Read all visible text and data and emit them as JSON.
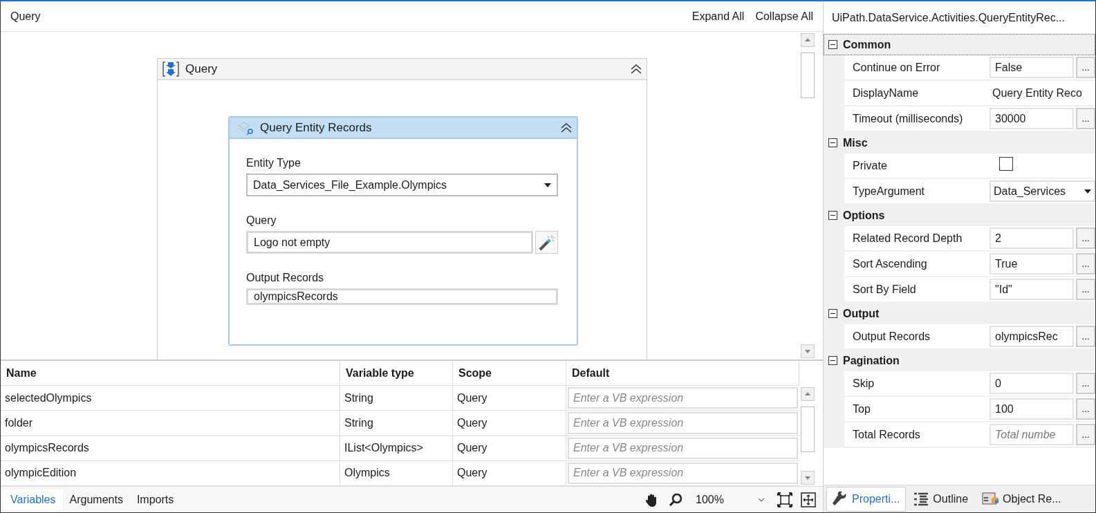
{
  "designer": {
    "breadcrumb": "Query",
    "actions": [
      "Expand All",
      "Collapse All"
    ],
    "sequence": {
      "title": "Query"
    },
    "activity": {
      "title": "Query Entity Records",
      "fields": [
        {
          "label": "Entity Type",
          "kind": "dropdown",
          "value": "Data_Services_File_Example.Olympics"
        },
        {
          "label": "Query",
          "kind": "builder",
          "value": "Logo not empty"
        },
        {
          "label": "Output Records",
          "kind": "text",
          "value": "olympicsRecords"
        }
      ]
    }
  },
  "variables": {
    "columns": [
      "Name",
      "Variable type",
      "Scope",
      "Default"
    ],
    "rows": [
      {
        "name": "selectedOlympics",
        "type": "String",
        "scope": "Query",
        "default_placeholder": "Enter a VB expression"
      },
      {
        "name": "folder",
        "type": "String",
        "scope": "Query",
        "default_placeholder": "Enter a VB expression"
      },
      {
        "name": "olympicsRecords",
        "type": "IList<Olympics>",
        "scope": "Query",
        "default_placeholder": "Enter a VB expression"
      },
      {
        "name": "olympicEdition",
        "type": "Olympics",
        "scope": "Query",
        "default_placeholder": "Enter a VB expression"
      }
    ]
  },
  "bottom_bar": {
    "tabs": [
      {
        "label": "Variables",
        "selected": true
      },
      {
        "label": "Arguments",
        "selected": false
      },
      {
        "label": "Imports",
        "selected": false
      }
    ],
    "zoom": "100%"
  },
  "properties": {
    "title": "UiPath.DataService.Activities.QueryEntityRec...",
    "categories": [
      {
        "name": "Common",
        "expanded": true,
        "selected": true,
        "rows": [
          {
            "label": "Continue on Error",
            "kind": "field",
            "value": "False"
          },
          {
            "label": "DisplayName",
            "kind": "plain",
            "value": "Query Entity Reco"
          },
          {
            "label": "Timeout (milliseconds)",
            "kind": "field",
            "value": "30000"
          }
        ]
      },
      {
        "name": "Misc",
        "expanded": true,
        "selected": false,
        "rows": [
          {
            "label": "Private",
            "kind": "checkbox",
            "checked": false
          },
          {
            "label": "TypeArgument",
            "kind": "dropdown",
            "value": "Data_Services"
          }
        ]
      },
      {
        "name": "Options",
        "expanded": true,
        "selected": false,
        "rows": [
          {
            "label": "Related Record Depth",
            "kind": "field",
            "value": "2"
          },
          {
            "label": "Sort Ascending",
            "kind": "field",
            "value": "True"
          },
          {
            "label": "Sort By Field",
            "kind": "field",
            "value": "\"Id\""
          }
        ]
      },
      {
        "name": "Output",
        "expanded": true,
        "selected": false,
        "rows": [
          {
            "label": "Output Records",
            "kind": "field",
            "value": "olympicsRec"
          }
        ]
      },
      {
        "name": "Pagination",
        "expanded": true,
        "selected": false,
        "rows": [
          {
            "label": "Skip",
            "kind": "field",
            "value": "0"
          },
          {
            "label": "Top",
            "kind": "field",
            "value": "100"
          },
          {
            "label": "Total Records",
            "kind": "field",
            "placeholder": "Total numbe"
          }
        ]
      }
    ]
  },
  "editor_button": "...",
  "panel_tabs": [
    {
      "label": "Properti...",
      "selected": true
    },
    {
      "label": "Outline",
      "selected": false
    },
    {
      "label": "Object Re...",
      "selected": false
    }
  ]
}
